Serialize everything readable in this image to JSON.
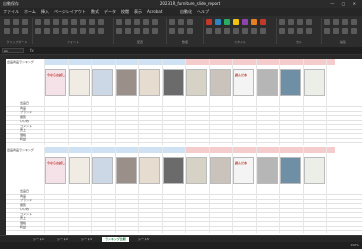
{
  "titlebar": {
    "left": "自動保存",
    "title": "20231R_furniture_slide_report",
    "controls": "— ▢ ✕"
  },
  "menu": [
    "ファイル",
    "ホーム",
    "挿入",
    "ページレイアウト",
    "数式",
    "データ",
    "校閲",
    "表示",
    "Acrobat",
    "自動化",
    "ヘルプ"
  ],
  "ribbon": {
    "groups": [
      "クリップボード",
      "フォント",
      "配置",
      "数値",
      "スタイル",
      "セル",
      "編集"
    ]
  },
  "formula_bar": {
    "name_box": "A1",
    "fx": "fx"
  },
  "blocks": [
    {
      "header": "出品商品ランキング",
      "row_labels": [
        "出品日",
        "商品",
        "ブランド",
        "閲覧",
        "いいね",
        "コメント",
        "売上",
        "価格",
        "利益"
      ]
    },
    {
      "header": "出品商品ランキング",
      "row_labels": [
        "出品日",
        "商品",
        "ブランド",
        "閲覧",
        "いいね",
        "コメント",
        "売上",
        "価格",
        "利益"
      ]
    }
  ],
  "photos": [
    {
      "text": "今ならお試し",
      "color": "#f5e1e8"
    },
    {
      "text": "",
      "color": "#f0ece4"
    },
    {
      "text": "",
      "color": "#cdd8e6"
    },
    {
      "text": "",
      "color": "#9b8f8a"
    },
    {
      "text": "",
      "color": "#e6dccf"
    },
    {
      "text": "",
      "color": "#6b6b6b"
    },
    {
      "text": "",
      "color": "#d7d2c6"
    },
    {
      "text": "",
      "color": "#c9c3bb"
    },
    {
      "text": "読んだ本",
      "color": "#f4f4f4"
    },
    {
      "text": "",
      "color": "#b6b6b6"
    },
    {
      "text": "",
      "color": "#6f8fa6"
    },
    {
      "text": "",
      "color": "#ecefe8"
    }
  ],
  "tabs": [
    "シート1",
    "シート2",
    "シート3",
    "ランキング比較",
    "シート5"
  ],
  "active_tab": "ランキング比較",
  "zoom": "100%",
  "colors": {
    "blue_band": "#cfe2f3",
    "red_band": "#f4cccc",
    "accent": "#1e7b3f"
  }
}
